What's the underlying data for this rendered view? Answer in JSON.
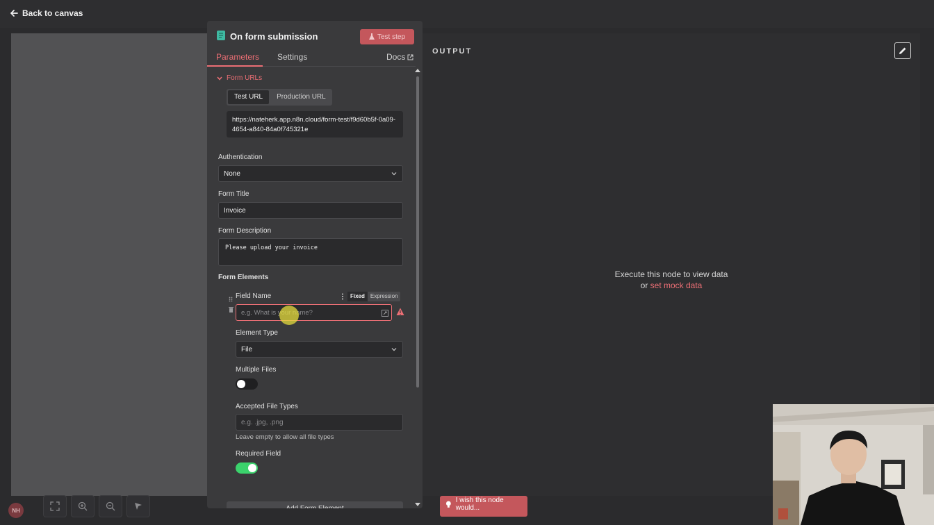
{
  "topbar": {
    "back_label": "Back to canvas"
  },
  "node": {
    "title": "On form submission",
    "test_step_label": "Test step",
    "tabs": [
      {
        "label": "Parameters",
        "active": true
      },
      {
        "label": "Settings",
        "active": false
      }
    ],
    "docs_label": "Docs"
  },
  "form_urls": {
    "label": "Form URLs",
    "tabs": [
      "Test URL",
      "Production URL"
    ],
    "active_tab": "Test URL",
    "url": "https://nateherk.app.n8n.cloud/form-test/f9d60b5f-0a09-4654-a840-84a0f745321e"
  },
  "authentication": {
    "label": "Authentication",
    "value": "None"
  },
  "form_title": {
    "label": "Form Title",
    "value": "Invoice"
  },
  "form_description": {
    "label": "Form Description",
    "value": "Please upload your invoice"
  },
  "form_elements": {
    "label": "Form Elements",
    "field_name": {
      "label": "Field Name",
      "placeholder": "e.g. What is your name?",
      "value": "",
      "mode_options": [
        "Fixed",
        "Expression"
      ],
      "mode": "Fixed"
    },
    "element_type": {
      "label": "Element Type",
      "value": "File"
    },
    "multiple_files": {
      "label": "Multiple Files",
      "on": false
    },
    "accepted_file_types": {
      "label": "Accepted File Types",
      "placeholder": "e.g. .jpg, .png",
      "hint": "Leave empty to allow all file types"
    },
    "required_field": {
      "label": "Required Field",
      "on": true
    },
    "add_label": "Add Form Element"
  },
  "output": {
    "label": "OUTPUT",
    "message": "Execute this node to view data",
    "or_text": "or",
    "mock_link": "set mock data"
  },
  "feedback": {
    "label": "I wish this node would..."
  },
  "user": {
    "initials": "NH"
  },
  "colors": {
    "accent": "#ec6f75",
    "toggle_on": "#3bd26c",
    "panel_bg": "#3a3a3c",
    "output_bg": "#2e2e30"
  },
  "icons": [
    "back-arrow-icon",
    "form-node-icon",
    "flask-icon",
    "external-link-icon",
    "chevron-down-icon",
    "drag-handle-icon",
    "trash-icon",
    "kebab-menu-icon",
    "expand-icon",
    "warning-icon",
    "pencil-icon",
    "lightbulb-icon",
    "fit-view-icon",
    "zoom-in-icon",
    "zoom-out-icon",
    "tidy-icon"
  ]
}
